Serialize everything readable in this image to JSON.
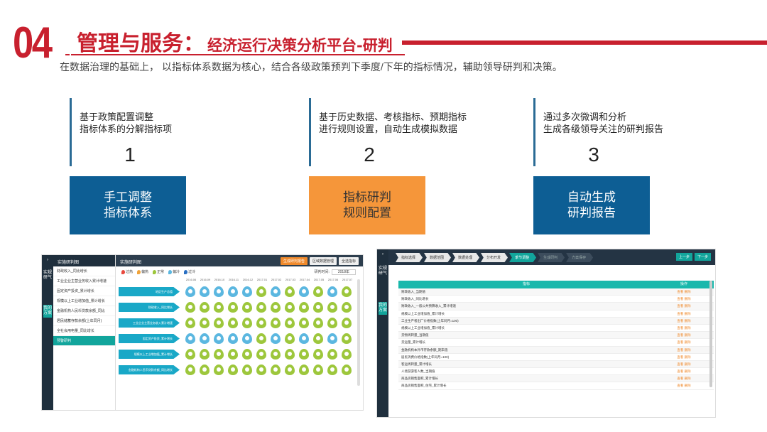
{
  "header": {
    "section_number": "04",
    "title": "管理与服务：",
    "subtitle_title": "经济运行决策分析平台-研判",
    "description": "在数据治理的基础上， 以指标体系数据为核心，结合各级政策预判下季度/下年的指标情况，辅助领导研判和决策。"
  },
  "steps": [
    {
      "number": "1",
      "desc_line1": "基于政策配置调整",
      "desc_line2": "指标体系的分解指标项",
      "box_line1": "手工调整",
      "box_line2": "指标体系"
    },
    {
      "number": "2",
      "desc_line1": "基于历史数据、考核指标、预期指标",
      "desc_line2": "进行规则设置，自动生成模拟数据",
      "box_line1": "指标研判",
      "box_line2": "规则配置"
    },
    {
      "number": "3",
      "desc_line1": "通过多次微调和分析",
      "desc_line2": "生成各级领导关注的研判报告",
      "box_line1": "自动生成",
      "box_line2": "研判报告"
    }
  ],
  "colors": {
    "accent_red": "#c8202e",
    "box_blue": "#0d5e94",
    "box_orange": "#f5963a",
    "teal": "#12a59c"
  },
  "shot1": {
    "side_tabs": [
      "实规研气",
      "我的方案"
    ],
    "menu_title": "实施研判图",
    "menu_items": [
      "财政收入_同比增长",
      "工业企业主营业务收入累计增速",
      "固定资产投资_累计增长",
      "规模以上工业增加值_累计增长",
      "金融机构人民币贷款余额_同比",
      "居民储蓄存款余额(上年同月)",
      "全社会用电量_同比增长",
      "预警研判"
    ],
    "panel_title": "实施研判图",
    "buttons": [
      "生成研判报告",
      "区域数据管理",
      "全选指标"
    ],
    "legend": [
      "过热",
      "偏热",
      "正常",
      "偏冷",
      "过冷"
    ],
    "year_label": "研判时间:",
    "year_value": "2018年",
    "months": [
      "2016.06",
      "2016.09",
      "2016.10",
      "2016.11",
      "2016.12",
      "2017.01",
      "2017.02",
      "2017.03",
      "2017.04",
      "2017.05",
      "2017.06",
      "2017.07"
    ],
    "rows": [
      "地区生产总值",
      "财政收入_同比增长",
      "工业企业主营业务收入累计增速",
      "固定资产投资_累计增长",
      "规模以上工业增加值_累计增长",
      "金融机构人民币贷款余额_同比增长"
    ]
  },
  "shot2": {
    "side_tabs": [
      "实规研气",
      "我的方案"
    ],
    "crumbs": [
      "指标选择",
      "数据范围",
      "数据处理",
      "分布开发",
      "季节调整",
      "生成研判",
      "方案保存"
    ],
    "buttons": [
      "上一步",
      "下一步"
    ],
    "col_indicator": "指标",
    "col_action": "操作",
    "action_text": "查看  删除",
    "rows": [
      "财政收入_当期值",
      "财政收入_同比增长",
      "财政收入_一般公共预算收入_累计增速",
      "规模以上工业增加值_累计增长",
      "工业生产者出厂价格指数(上年同月=100)",
      "规模以上工业增加值_累计增长",
      "货物周转量_当期值",
      "货运量_累计增长",
      "金融机构本外币存款余额_期末值",
      "居民消费价格指数(上年同月=100)",
      "客运周转量_累计增长",
      "人境游游客人数_当期值",
      "商品房销售面积_累计增长",
      "商品房销售面积_住宅_累计增长"
    ]
  }
}
